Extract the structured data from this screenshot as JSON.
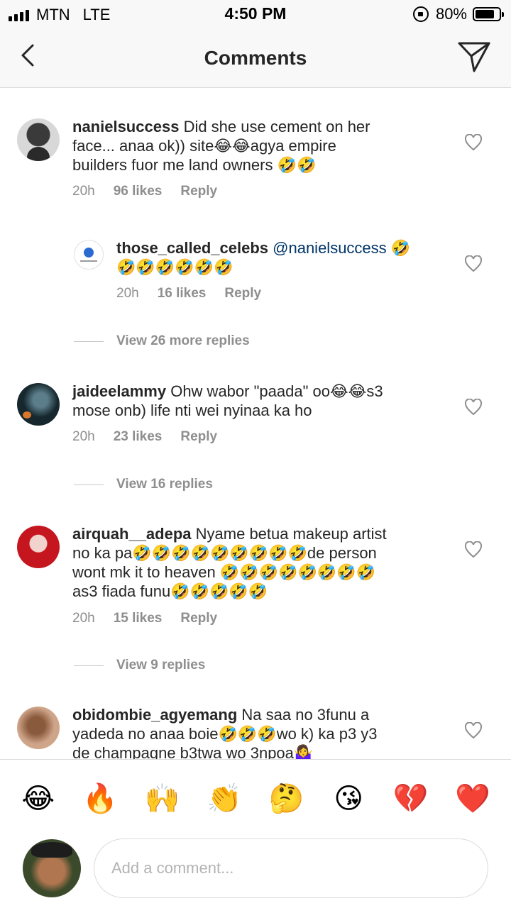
{
  "status_bar": {
    "carrier": "MTN",
    "network": "LTE",
    "time": "4:50 PM",
    "battery": "80%",
    "battery_level": 0.8
  },
  "header": {
    "title": "Comments",
    "back_icon": "chevron-left-icon",
    "send_icon": "paper-plane-icon"
  },
  "comments": [
    {
      "username": "nanielsuccess",
      "lines": [
        "Did she use cement on her",
        "face... anaa ok)) site😂😂agya empire",
        "builders fuor me land owners 🤣🤣"
      ],
      "time": "20h",
      "likes": "96 likes",
      "reply": "Reply"
    },
    {
      "username": "those_called_celebs",
      "mention": "@nanielsuccess",
      "lines": [
        " 🤣",
        "🤣🤣🤣🤣🤣🤣"
      ],
      "time": "20h",
      "likes": "16 likes",
      "reply": "Reply",
      "is_reply": true
    },
    {
      "username": "jaideelammy",
      "lines": [
        "Ohw wabor \"paada\" oo😂😂s3",
        "mose onb) life nti wei nyinaa ka ho"
      ],
      "time": "20h",
      "likes": "23 likes",
      "reply": "Reply"
    },
    {
      "username": "airquah__adepa",
      "lines": [
        "Nyame betua makeup artist",
        "no ka pa🤣🤣🤣🤣🤣🤣🤣🤣🤣de person",
        "wont mk it to heaven 🤣🤣🤣🤣🤣🤣🤣🤣",
        "as3 fiada funu🤣🤣🤣🤣🤣"
      ],
      "time": "20h",
      "likes": "15 likes",
      "reply": "Reply"
    },
    {
      "username": "obidombie_agyemang",
      "lines": [
        "Na saa no 3funu a",
        "yadeda no anaa boie🤣🤣🤣wo k) ka p3 y3",
        "de champagne b3twa wo 3npoa🤷‍♀️"
      ]
    }
  ],
  "view_replies": [
    "View 26 more replies",
    "View 16 replies",
    "View 9 replies"
  ],
  "emoji_bar": [
    "😂",
    "🔥",
    "🙌",
    "👏",
    "🤔",
    "😘",
    "💔",
    "❤️"
  ],
  "compose": {
    "placeholder": "Add a comment..."
  },
  "colors": {
    "text": "#262626",
    "secondary": "#8e8e8e",
    "mention": "#003569",
    "divider": "#dbdbdb",
    "bar_bg": "#f8f8f8"
  }
}
